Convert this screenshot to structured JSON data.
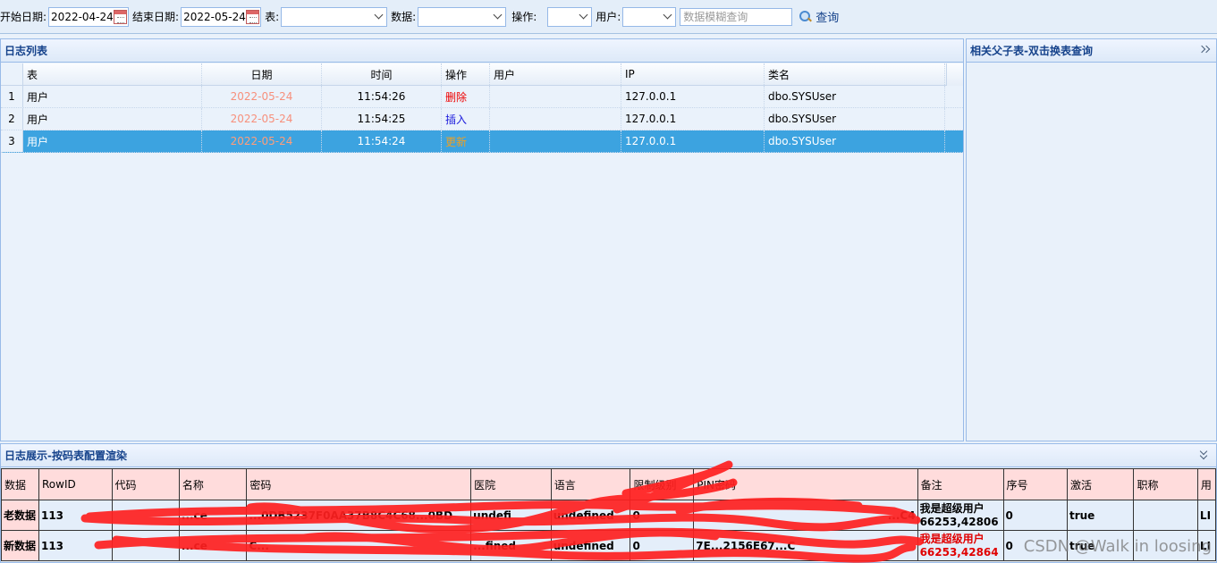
{
  "toolbar": {
    "start_label": "开始日期:",
    "start_value": "2022-04-24",
    "end_label": "结束日期:",
    "end_value": "2022-05-24",
    "table_label": "表:",
    "data_label": "数据:",
    "op_label": "操作:",
    "user_label": "用户:",
    "search_placeholder": "数据模糊查询",
    "query_label": "查询"
  },
  "log_panel": {
    "title": "日志列表",
    "columns": [
      "表",
      "日期",
      "时间",
      "操作",
      "用户",
      "IP",
      "类名"
    ],
    "rows": [
      {
        "num": "1",
        "table": "用户",
        "date": "2022-05-24",
        "time": "11:54:26",
        "op": "删除",
        "user": "",
        "ip": "127.0.0.1",
        "cls": "dbo.SYSUser"
      },
      {
        "num": "2",
        "table": "用户",
        "date": "2022-05-24",
        "time": "11:54:25",
        "op": "插入",
        "user": "",
        "ip": "127.0.0.1",
        "cls": "dbo.SYSUser"
      },
      {
        "num": "3",
        "table": "用户",
        "date": "2022-05-24",
        "time": "11:54:24",
        "op": "更新",
        "user": "",
        "ip": "127.0.0.1",
        "cls": "dbo.SYSUser"
      }
    ],
    "selected_row": 3
  },
  "related_panel": {
    "title": "相关父子表-双击换表查询"
  },
  "detail_panel": {
    "title": "日志展示-按码表配置渲染",
    "headers": [
      "数据",
      "RowID",
      "代码",
      "名称",
      "密码",
      "医院",
      "语言",
      "限制级别",
      "PIN密码",
      "备注",
      "序号",
      "激活",
      "职称",
      "用"
    ],
    "old_row": {
      "label": "老数据",
      "rowid": "113",
      "code": "",
      "name": "...ce",
      "password": "...0DB5237F0AA37B8C4C68...0BD",
      "hospital": "undefi",
      "language": "undefined",
      "limit": "0",
      "pin": "...C4",
      "remark_line1": "我是超级用户",
      "remark_line2": "66253,42806",
      "seq": "0",
      "active": "true",
      "title_": "",
      "extra": "LI"
    },
    "new_row": {
      "label": "新数据",
      "rowid": "113",
      "code": "",
      "name": "...ce",
      "password": "C...",
      "hospital": "...fined",
      "language": "undefined",
      "limit": "0",
      "pin": "7E...2156E67...C",
      "remark_line1": "我是超级用户",
      "remark_line2": "66253,42864",
      "seq": "0",
      "active": "true",
      "title_": "",
      "extra": "LI"
    }
  },
  "watermark": "CSDN @Walk in loosing",
  "colors": {
    "accent": "#15428b",
    "selected_row": "#3ca3e0",
    "header_pink": "#ffdcdc",
    "scribble": "#ff2020"
  }
}
